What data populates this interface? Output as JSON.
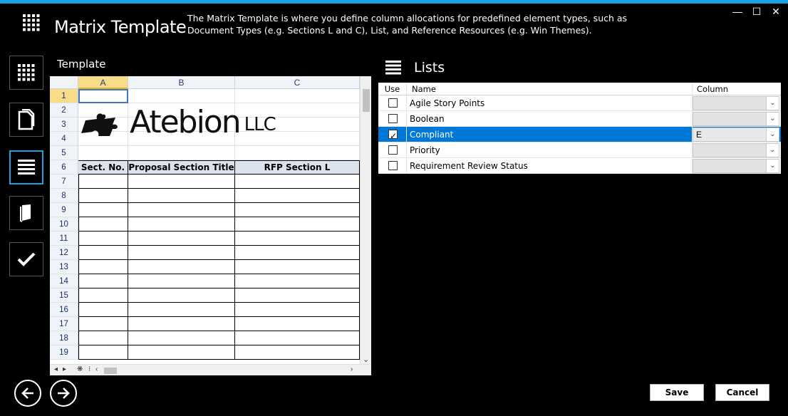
{
  "window": {
    "title": "Matrix Template",
    "description": "The Matrix Template is where you define column allocations for predefined element types, such as Document Types (e.g. Sections L and C), List, and Reference Resources (e.g. Win Themes).",
    "minimize_glyph": "—",
    "maximize_glyph": "☐",
    "close_glyph": "✕"
  },
  "sidebar": {
    "items": [
      {
        "icon": "grid-icon"
      },
      {
        "icon": "document-icon"
      },
      {
        "icon": "list-icon",
        "active": true
      },
      {
        "icon": "book-icon"
      },
      {
        "icon": "checkmark-icon"
      }
    ]
  },
  "template": {
    "label": "Template",
    "columns": [
      "A",
      "B",
      "C"
    ],
    "rows": [
      "1",
      "2",
      "3",
      "4",
      "5",
      "6",
      "7",
      "8",
      "9",
      "10",
      "11",
      "12",
      "13",
      "14",
      "15",
      "16",
      "17",
      "18",
      "19"
    ],
    "logo_text": "Atebion",
    "logo_suffix": "LLC",
    "table_headers": [
      "Sect. No.",
      "Proposal Section Title",
      "RFP Section L"
    ],
    "scroll_glyphs": {
      "first": "◂",
      "last": "▸",
      "add": "❋",
      "sep": "⁝",
      "left": "‹",
      "right": "›",
      "down": "⌄"
    }
  },
  "lists": {
    "title": "Lists",
    "headers": {
      "use": "Use",
      "name": "Name",
      "column": "Column"
    },
    "rows": [
      {
        "name": "Agile Story Points",
        "checked": false,
        "column": ""
      },
      {
        "name": "Boolean",
        "checked": false,
        "column": ""
      },
      {
        "name": "Compliant",
        "checked": true,
        "column": "E"
      },
      {
        "name": "Priority",
        "checked": false,
        "column": ""
      },
      {
        "name": "Requirement Review Status",
        "checked": false,
        "column": ""
      }
    ]
  },
  "footer": {
    "save_label": "Save",
    "cancel_label": "Cancel"
  },
  "colors": {
    "accent": "#1ba1e2",
    "selection": "#0078d7",
    "header_fill": "#dce3ef"
  }
}
